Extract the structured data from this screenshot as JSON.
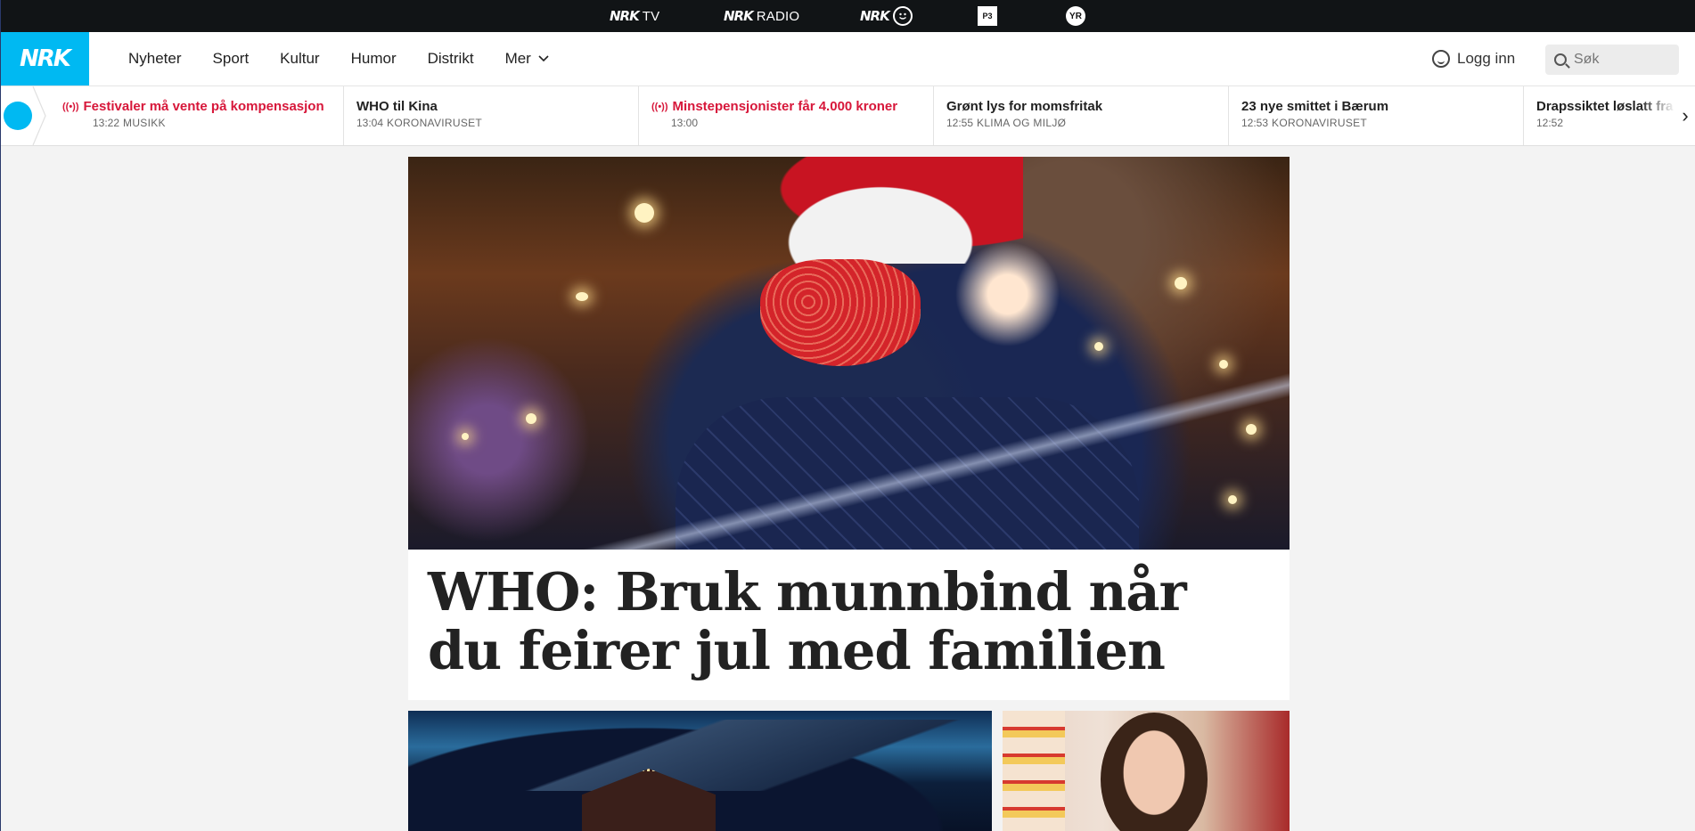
{
  "services": [
    {
      "brand": "NRK",
      "label": "TV"
    },
    {
      "brand": "NRK",
      "label": "RADIO"
    },
    {
      "brand": "NRK",
      "label": "",
      "icon": "smiley-icon"
    },
    {
      "brand": "",
      "label": "P3",
      "icon": "p3-icon"
    },
    {
      "brand": "",
      "label": "YR",
      "icon": "yr-icon"
    }
  ],
  "header": {
    "logo": "NRK",
    "nav": [
      "Nyheter",
      "Sport",
      "Kultur",
      "Humor",
      "Distrikt",
      "Mer"
    ],
    "login_label": "Logg inn",
    "search_placeholder": "Søk"
  },
  "colors": {
    "brand": "#00b9f2",
    "live": "#d7173a"
  },
  "ticker": [
    {
      "title": "Festivaler må vente på kompensasjon",
      "time": "13:22",
      "category": "MUSIKK",
      "live": true
    },
    {
      "title": "WHO til Kina",
      "time": "13:04",
      "category": "KORONAVIRUSET",
      "live": false
    },
    {
      "title": "Minstepensjonister får 4.000 kroner",
      "time": "13:00",
      "category": "",
      "live": true
    },
    {
      "title": "Grønt lys for momsfritak",
      "time": "12:55",
      "category": "KLIMA OG MILJØ",
      "live": false
    },
    {
      "title": "23 nye smittet i Bærum",
      "time": "12:53",
      "category": "KORONAVIRUSET",
      "live": false
    },
    {
      "title": "Drapssiktet løslatt fra",
      "time": "12:52",
      "category": "",
      "live": false
    }
  ],
  "main_article": {
    "title": "WHO: Bruk munnbind når du feirer jul med familien"
  }
}
